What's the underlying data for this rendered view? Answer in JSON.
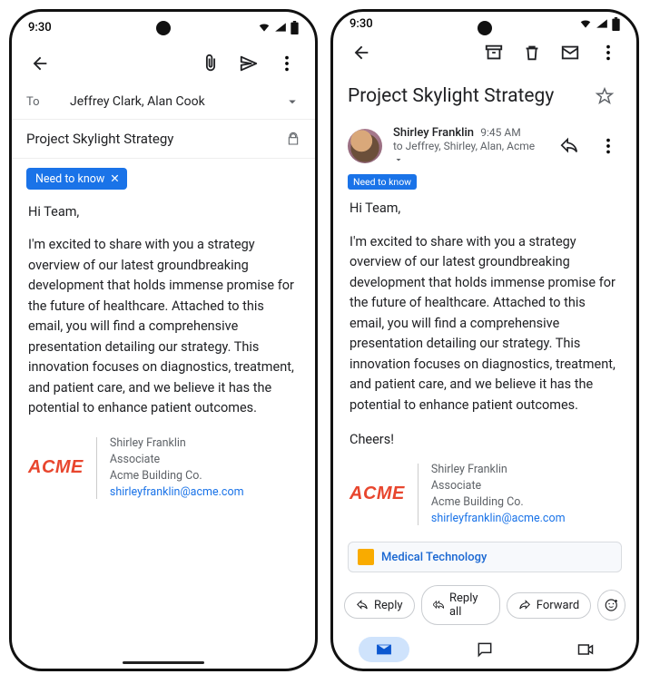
{
  "status": {
    "time": "9:30"
  },
  "compose": {
    "to_label": "To",
    "recipients": "Jeffrey Clark, Alan Cook",
    "subject": "Project Skylight Strategy",
    "label": "Need to know",
    "greeting": "Hi Team,",
    "body": "I'm excited to share with you a strategy overview of our latest groundbreaking development that holds immense promise for the future of healthcare. Attached to this email, you will find a comprehensive presentation detailing our strategy. This innovation focuses on diagnostics, treatment, and patient care, and we believe it has the potential to enhance patient outcomes."
  },
  "signature": {
    "logo": "ACME",
    "name": "Shirley Franklin",
    "role": "Associate",
    "company": "Acme Building Co.",
    "email": "shirleyfranklin@acme.com"
  },
  "reader": {
    "subject": "Project Skylight Strategy",
    "sender_name": "Shirley Franklin",
    "time": "9:45 AM",
    "recipients_line": "to Jeffrey, Shirley, Alan, Acme",
    "label": "Need to know",
    "greeting": "Hi Team,",
    "body": "I'm excited to share with you a strategy overview of our latest groundbreaking development that holds immense promise for the future of healthcare. Attached to this email, you will find a comprehensive presentation detailing our strategy. This innovation focuses on diagnostics, treatment, and patient care, and we believe it has the potential to enhance patient outcomes.",
    "signoff": "Cheers!",
    "attachment": "Medical Technology",
    "reply_labels": {
      "reply": "Reply",
      "reply_all": "Reply all",
      "forward": "Forward"
    }
  }
}
